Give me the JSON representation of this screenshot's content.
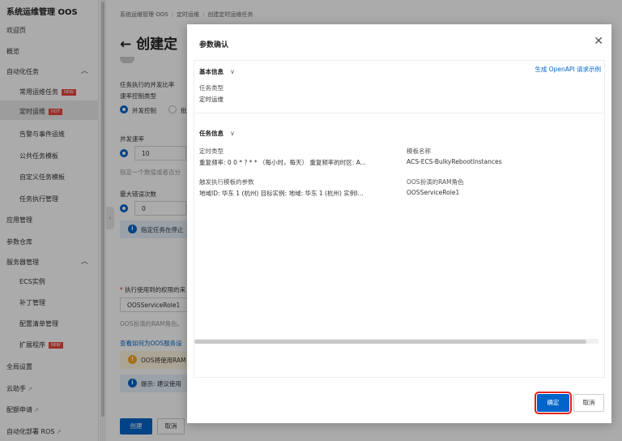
{
  "sidebar": {
    "title": "系统运维管理 OOS",
    "welcome": "欢迎页",
    "overview": "概览",
    "automation": "自动化任务",
    "automation_items": [
      {
        "label": "常用运维任务",
        "badge": "NEW"
      },
      {
        "label": "定时运维",
        "badge": "HOT"
      },
      {
        "label": "告警与事件运维"
      },
      {
        "label": "公共任务模板"
      },
      {
        "label": "自定义任务模板"
      },
      {
        "label": "任务执行管理"
      }
    ],
    "app_mgmt": "应用管理",
    "param_store": "参数仓库",
    "server_mgmt": "服务器管理",
    "server_items": [
      {
        "label": "ECS实例"
      },
      {
        "label": "补丁管理"
      },
      {
        "label": "配置清单管理"
      },
      {
        "label": "扩展程序",
        "badge": "NEW"
      }
    ],
    "global_settings": "全局设置",
    "cloud_assistant": "云助手",
    "quota": "配额申请",
    "ros": "自动化部署 ROS"
  },
  "breadcrumb": {
    "items": [
      "系统运维管理 OOS",
      "定时运维",
      "创建定时运维任务"
    ]
  },
  "page": {
    "title": "创建定",
    "concurrency_label": "任务执行的并发比率",
    "rate_type_label": "速率控制类型",
    "rate_option_1": "并发控制",
    "rate_option_2": "批",
    "concurrency_rate_label": "并发速率",
    "concurrency_value": "10",
    "concurrency_hint": "指定一个数值或者百分",
    "max_errors_label": "最大错误次数",
    "max_errors_value": "0",
    "stop_info": "指定任务在停止",
    "ram_role_label": "执行使用到的权限的来",
    "ram_role_value": "OOSServiceRole1",
    "ram_role_hint": "OOS扮演的RAM角色。",
    "ram_link": "查看如何为OOS服务设",
    "ram_warning": "OOS将使用RAM",
    "tip": "提示: 建议使用",
    "create_button": "创建",
    "cancel_button": "取消"
  },
  "modal": {
    "title": "参数确认",
    "basic_section": "基本信息",
    "openapi_link": "生成 OpenAPI 请求示例",
    "task_type_label": "任务类型",
    "task_type_value": "定时运维",
    "task_section": "任务信息",
    "schedule_type_label": "定时类型",
    "schedule_type_value": "重复频率: 0 0 * ? * * （每小时，每天） 重复频率的时区: A...",
    "template_name_label": "模板名称",
    "template_name_value": "ACS-ECS-BulkyRebootInstances",
    "trigger_params_label": "触发执行模板的参数",
    "trigger_params_value": "地域ID: 华东 1 (杭州) 目标实例: 地域: 华东 1 (杭州) 实例I...",
    "ram_role_label": "OOS扮演的RAM角色",
    "ram_role_value": "OOSServiceRole1",
    "ok_button": "确定",
    "cancel_button": "取消"
  },
  "colors": {
    "primary": "#0064c8",
    "highlight": "#e1251b",
    "badge": "#e8483e"
  }
}
